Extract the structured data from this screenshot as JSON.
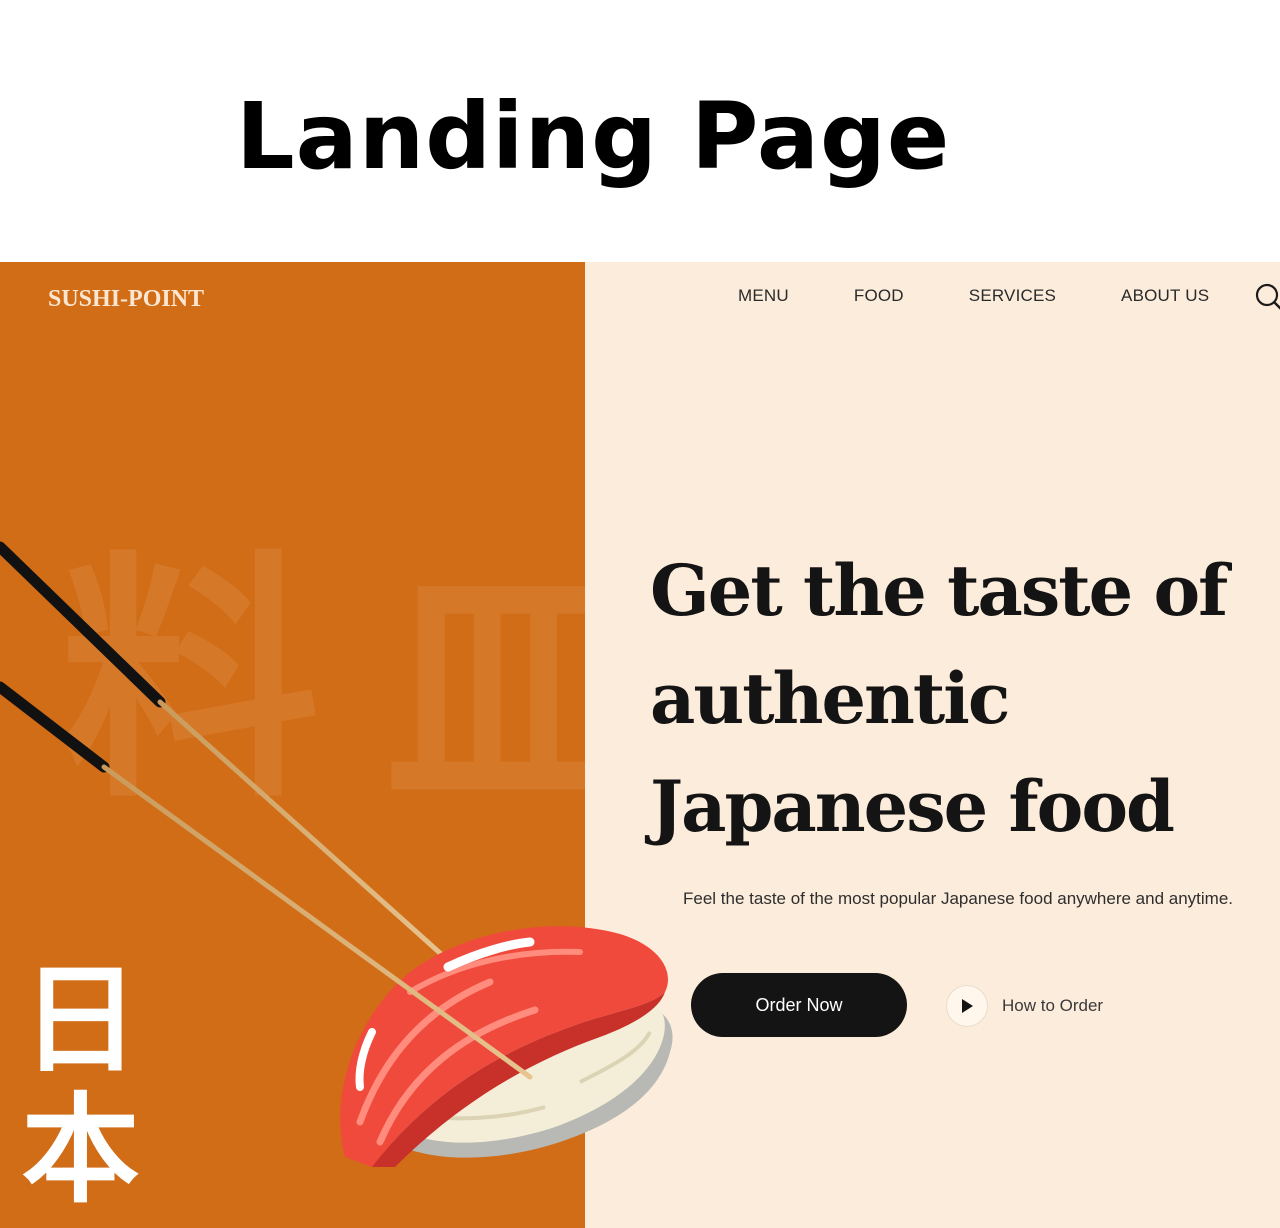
{
  "caption": {
    "title": "Landing Page"
  },
  "site": {
    "logo": "SUSHI-POINT",
    "nav": {
      "items": [
        "MENU",
        "FOOD",
        "SERVICES",
        "ABOUT US"
      ]
    },
    "search_icon": "search-icon",
    "hero": {
      "title_lines": [
        "Get the taste of",
        "authentic",
        "Japanese food"
      ],
      "subtitle": "Feel the taste of the most popular Japanese food anywhere and anytime.",
      "primary_button": "Order Now",
      "secondary_button": "How to Order"
    },
    "decor": {
      "vertical_kanji": [
        "日",
        "本"
      ],
      "watermark_glyphs": [
        "料",
        "皿"
      ]
    },
    "colors": {
      "orange_panel": "#d16c17",
      "cream_panel": "#fcecdb",
      "dark": "#141414",
      "tuna": "#ef4a3c"
    }
  }
}
